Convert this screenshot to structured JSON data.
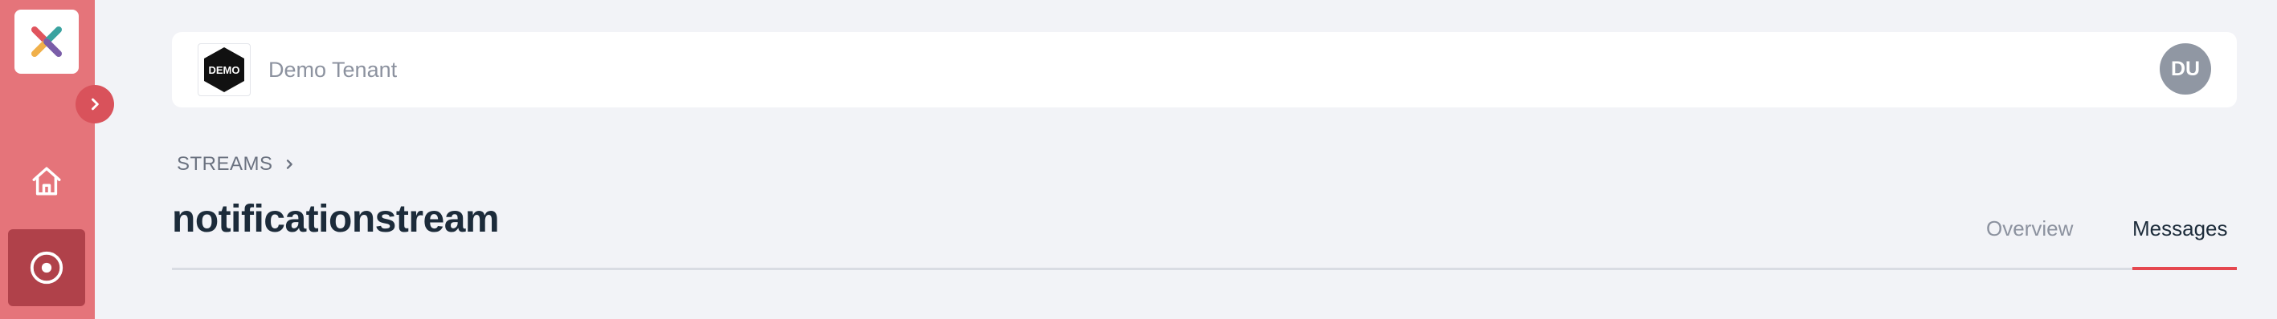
{
  "sidebar": {
    "logo_icon": "x-logo-icon",
    "expand_icon": "chevron-right-icon",
    "items": [
      {
        "name": "home",
        "icon": "home-icon",
        "active": false
      },
      {
        "name": "streams",
        "icon": "target-icon",
        "active": true
      }
    ],
    "colors": {
      "background": "#e5747a",
      "active": "#b0414a",
      "expand": "#d9525b"
    }
  },
  "header": {
    "tenant_logo_text": "DEMO",
    "tenant_name": "Demo Tenant",
    "avatar_initials": "DU"
  },
  "breadcrumb": {
    "label": "STREAMS"
  },
  "page": {
    "title": "notificationstream"
  },
  "tabs": [
    {
      "label": "Overview",
      "active": false
    },
    {
      "label": "Messages",
      "active": true
    }
  ],
  "colors": {
    "accent": "#e5474f",
    "page_background": "#f2f3f7",
    "title_text": "#1c2b3a",
    "muted_text": "#8c929f"
  }
}
